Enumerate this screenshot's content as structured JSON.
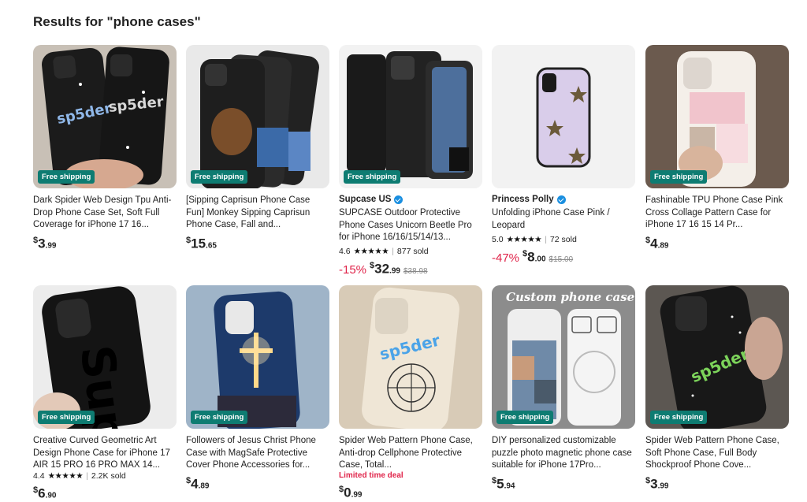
{
  "heading": "Results for \"phone cases\"",
  "badge": "Free shipping",
  "products": [
    {
      "store": "",
      "title": "Dark Spider Web Design Tpu Anti-Drop Phone Case Set, Soft Full Coverage for iPhone 17 16...",
      "rating": "",
      "sold": "",
      "deal": "",
      "discount": "",
      "price_whole": "3",
      "price_cents": ".99",
      "orig_price": ""
    },
    {
      "store": "",
      "title": "[Sipping Caprisun Phone Case Fun] Monkey Sipping Caprisun Phone Case, Fall and...",
      "rating": "",
      "sold": "",
      "deal": "",
      "discount": "",
      "price_whole": "15",
      "price_cents": ".65",
      "orig_price": ""
    },
    {
      "store": "Supcase US",
      "title": "SUPCASE Outdoor Protective Phone Cases Unicorn Beetle Pro for iPhone 16/16/15/14/13...",
      "rating": "4.6",
      "sold": "877 sold",
      "deal": "",
      "discount": "-15%",
      "price_whole": "32",
      "price_cents": ".99",
      "orig_price": "$38.98"
    },
    {
      "store": "Princess Polly",
      "title": "Unfolding iPhone Case Pink / Leopard",
      "rating": "5.0",
      "sold": "72 sold",
      "deal": "",
      "discount": "-47%",
      "price_whole": "8",
      "price_cents": ".00",
      "orig_price": "$15.00"
    },
    {
      "store": "",
      "title": "Fashinable TPU Phone Case Pink Cross Collage Pattern Case for iPhone 17 16 15 14 Pr...",
      "rating": "",
      "sold": "",
      "deal": "",
      "discount": "",
      "price_whole": "4",
      "price_cents": ".89",
      "orig_price": ""
    },
    {
      "store": "",
      "title": "Creative Curved Geometric Art Design Phone Case for iPhone 17 AIR 15 PRO 16 PRO MAX 14...",
      "rating": "4.4",
      "sold": "2.2K sold",
      "deal": "",
      "discount": "",
      "price_whole": "6",
      "price_cents": ".90",
      "orig_price": ""
    },
    {
      "store": "",
      "title": "Followers of Jesus Christ Phone Case with MagSafe Protective Cover Phone Accessories for...",
      "rating": "",
      "sold": "",
      "deal": "",
      "discount": "",
      "price_whole": "4",
      "price_cents": ".89",
      "orig_price": ""
    },
    {
      "store": "",
      "title": "Spider Web Pattern Phone Case, Anti-drop Cellphone Protective Case, Total...",
      "rating": "",
      "sold": "",
      "deal": "Limited time deal",
      "discount": "",
      "price_whole": "0",
      "price_cents": ".99",
      "orig_price": ""
    },
    {
      "store": "",
      "title": "DIY personalized customizable puzzle photo magnetic phone case suitable for iPhone 17Pro...",
      "rating": "",
      "sold": "",
      "deal": "",
      "discount": "",
      "price_whole": "5",
      "price_cents": ".94",
      "orig_price": ""
    },
    {
      "store": "",
      "title": "Spider Web Pattern Phone Case, Soft Phone Case, Full Body Shockproof Phone Cove...",
      "rating": "",
      "sold": "",
      "deal": "",
      "discount": "",
      "price_whole": "3",
      "price_cents": ".99",
      "orig_price": ""
    }
  ],
  "image_texts": {
    "spider_logo": "sp5der",
    "custom_case": "Custom phone case",
    "sup_logo": "Sup"
  },
  "colors": {
    "badge_bg": "#0e7c72",
    "discount": "#e0244a",
    "verified": "#1a8fe0"
  }
}
